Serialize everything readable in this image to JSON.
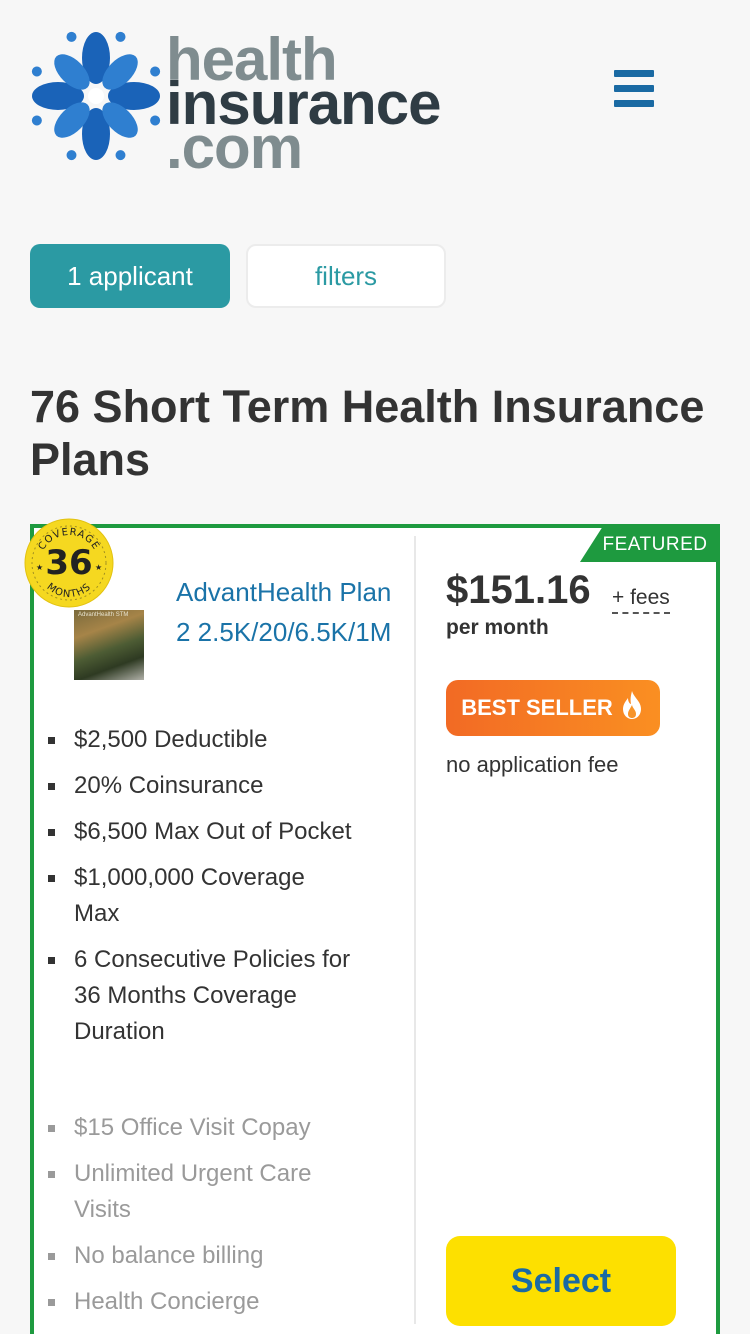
{
  "header": {
    "logo": {
      "line1": "health",
      "line2": "insurance",
      "line3": ".com"
    },
    "menu_icon": "hamburger-menu-icon"
  },
  "filters_bar": {
    "applicant_label": "1 applicant",
    "filters_label": "filters"
  },
  "page_title": "76 Short Term Health Insurance Plans",
  "plan_card": {
    "featured_label": "FEATURED",
    "badge": {
      "top_text": "COVERAGE",
      "number": "36",
      "bottom_text": "MONTHS"
    },
    "thumbnail_label": "AdvantHealth STM",
    "plan_name": "AdvantHealth Plan 2 2.5K/20/6.5K/1M",
    "features": [
      "$2,500 Deductible",
      "20% Coinsurance",
      "$6,500 Max Out of Pocket",
      "$1,000,000 Coverage Max",
      "6 Consecutive Policies for 36 Months Coverage Duration"
    ],
    "extras": [
      "$15 Office Visit Copay",
      "Unlimited Urgent Care Visits",
      "No balance billing",
      "Health Concierge"
    ],
    "price": "$151.16",
    "fees_label": "+ fees",
    "per_month_label": "per month",
    "best_seller_label": "BEST SELLER",
    "application_fee_note": "no application fee",
    "select_label": "Select"
  },
  "colors": {
    "teal": "#2b9aa3",
    "featured_green": "#1e9a3f",
    "link_blue": "#1a73a8",
    "select_yellow": "#fde000",
    "best_seller_orange": "#f26a24"
  }
}
